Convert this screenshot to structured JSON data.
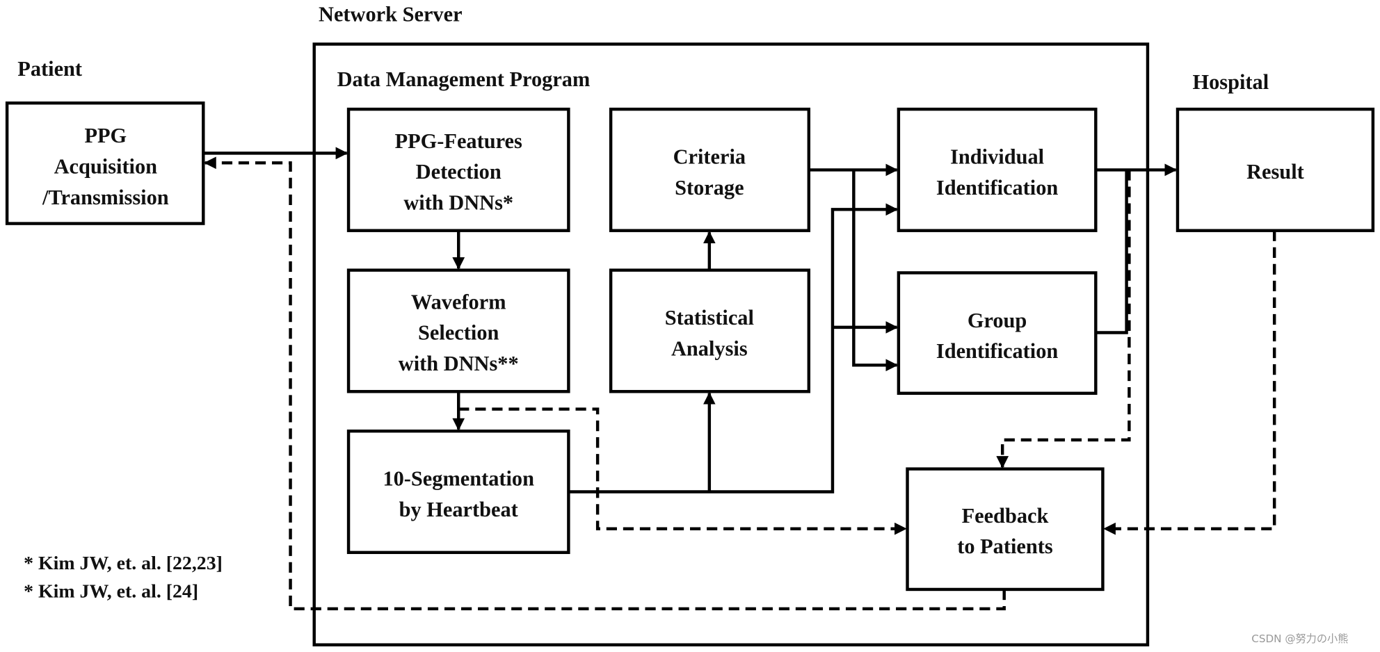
{
  "headers": {
    "network_server": "Network Server",
    "patient": "Patient",
    "data_management": "Data Management Program",
    "hospital": "Hospital"
  },
  "nodes": {
    "ppg_acq": [
      "PPG",
      "Acquisition",
      "/Transmission"
    ],
    "ppg_features": [
      "PPG-Features",
      "Detection",
      "with DNNs*"
    ],
    "criteria": [
      "Criteria",
      "Storage"
    ],
    "individual": [
      "Individual",
      "Identification"
    ],
    "result": [
      "Result"
    ],
    "waveform": [
      "Waveform",
      "Selection",
      "with DNNs**"
    ],
    "statistical": [
      "Statistical",
      "Analysis"
    ],
    "group": [
      "Group",
      "Identification"
    ],
    "segmentation": [
      "10-Segmentation",
      "by Heartbeat"
    ],
    "feedback": [
      "Feedback",
      "to Patients"
    ]
  },
  "footnotes": [
    "* Kim JW, et. al. [22,23]",
    "* Kim JW, et. al. [24]"
  ],
  "watermark": "CSDN @努力の小熊"
}
